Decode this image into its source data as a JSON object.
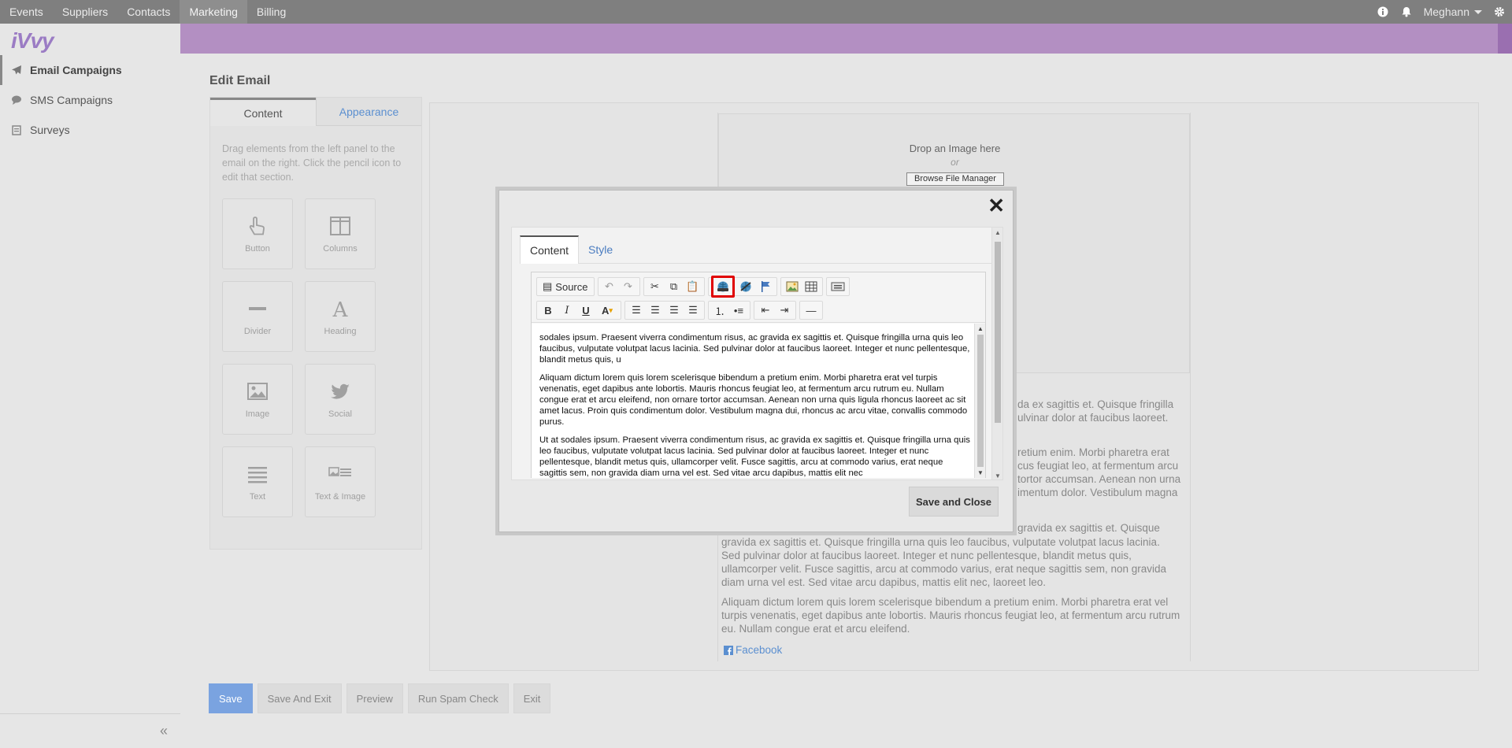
{
  "topnav": {
    "items": [
      "Events",
      "Suppliers",
      "Contacts",
      "Marketing",
      "Billing"
    ],
    "active": "Marketing",
    "user": "Meghann"
  },
  "sidebar": {
    "logo": "iVvy",
    "items": [
      {
        "label": "Email Campaigns",
        "icon": "paper-plane-icon"
      },
      {
        "label": "SMS Campaigns",
        "icon": "chat-bubble-icon"
      },
      {
        "label": "Surveys",
        "icon": "clipboard-icon"
      }
    ],
    "collapse": "«"
  },
  "page": {
    "title": "Edit Email",
    "tabs": [
      "Content",
      "Appearance"
    ],
    "help": "Drag elements from the left panel to the email on the right. Click the pencil icon to edit that section.",
    "elements": [
      "Button",
      "Columns",
      "Divider",
      "Heading",
      "Image",
      "Social",
      "Text",
      "Text & Image"
    ]
  },
  "preview": {
    "drop_text": "Drop an Image here",
    "drop_or": "or",
    "browse": "Browse File Manager",
    "text1": "da ex sagittis et. Quisque fringilla ulvinar dolor at faucibus laoreet.",
    "text2": "retium enim. Morbi pharetra erat cus feugiat leo, at fermentum arcu tortor accumsan. Aenean non urna imentum dolor. Vestibulum magna",
    "text3": "gravida ex sagittis et. Quisque fringilla urna quis leo faucibus, vulputate volutpat lacus lacinia. Sed pulvinar dolor at faucibus laoreet. Integer et nunc pellentesque, blandit metus quis, ullamcorper velit. Fusce sagittis, arcu at commodo varius, erat neque sagittis sem, non gravida diam urna vel est. Sed vitae arcu dapibus, mattis elit nec, laoreet leo.",
    "text4": "Aliquam dictum lorem quis lorem scelerisque bibendum a pretium enim. Morbi pharetra erat vel turpis venenatis, eget dapibus ante lobortis. Mauris rhoncus feugiat leo, at fermentum arcu rutrum eu. Nullam congue erat et arcu eleifend.",
    "facebook": "Facebook"
  },
  "actions": [
    "Save",
    "Save And Exit",
    "Preview",
    "Run Spam Check",
    "Exit"
  ],
  "modal": {
    "tabs": [
      "Content",
      "Style"
    ],
    "source": "Source",
    "p1": "sodales ipsum. Praesent viverra condimentum risus, ac gravida ex sagittis et. Quisque fringilla urna quis leo faucibus, vulputate volutpat lacus lacinia. Sed pulvinar dolor at faucibus laoreet. Integer et nunc pellentesque, blandit metus quis, u",
    "p2": "Aliquam dictum lorem quis lorem scelerisque bibendum a pretium enim. Morbi pharetra erat vel turpis venenatis, eget dapibus ante lobortis. Mauris rhoncus feugiat leo, at fermentum arcu rutrum eu. Nullam congue erat et arcu eleifend, non ornare tortor accumsan. Aenean non urna quis ligula rhoncus laoreet ac sit amet lacus. Proin quis condimentum dolor. Vestibulum magna dui, rhoncus ac arcu vitae, convallis commodo purus.",
    "p3": "Ut at sodales ipsum. Praesent viverra condimentum risus, ac gravida ex sagittis et. Quisque fringilla urna quis leo faucibus, vulputate volutpat lacus lacinia. Sed pulvinar dolor at faucibus laoreet. Integer et nunc pellentesque, blandit metus quis, ullamcorper velit. Fusce sagittis, arcu at commodo varius, erat neque sagittis sem, non gravida diam urna vel est. Sed vitae arcu dapibus, mattis elit nec",
    "save_close": "Save and Close"
  },
  "colors": {
    "accent_purple": "#b38fc2",
    "link_blue": "#5b8fd0",
    "primary_button": "#7aa3e0",
    "highlight_red": "#e00000"
  }
}
